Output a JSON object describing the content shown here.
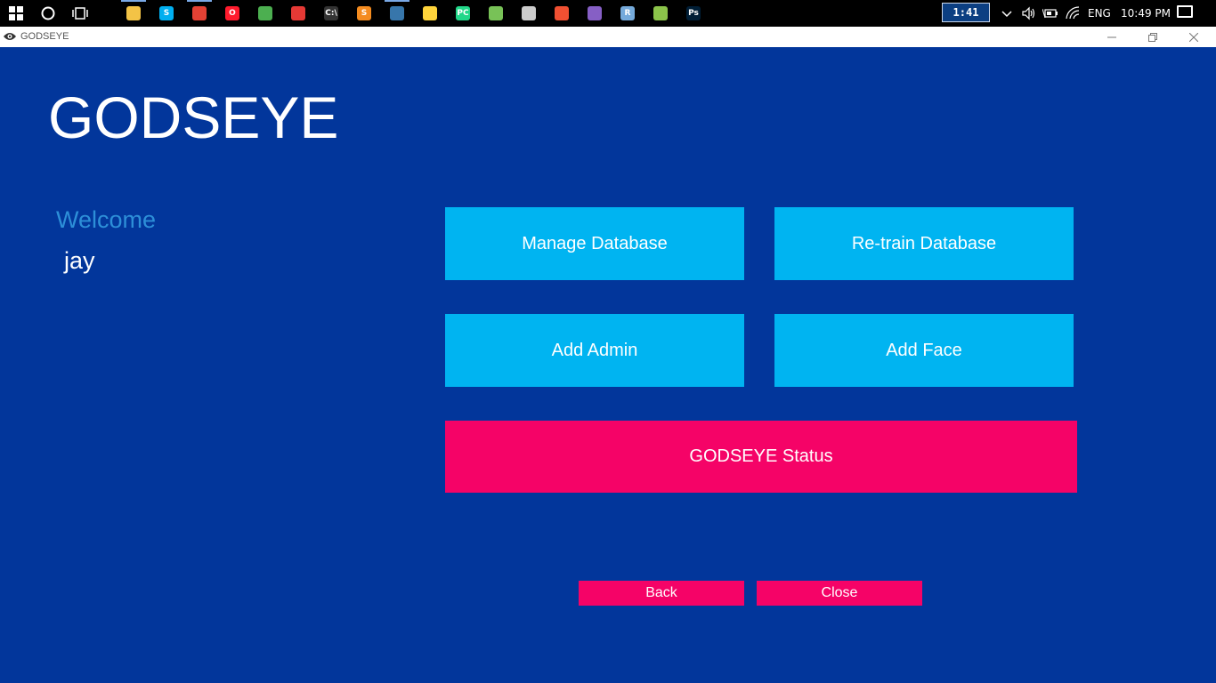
{
  "taskbar": {
    "pinned": [
      {
        "name": "file-explorer-icon",
        "color": "#f3c346",
        "glyph": "",
        "running": true
      },
      {
        "name": "skype-icon",
        "color": "#00aff0",
        "glyph": "S",
        "running": false
      },
      {
        "name": "chrome-icon",
        "color": "#e44134",
        "glyph": "",
        "running": true
      },
      {
        "name": "opera-icon",
        "color": "#ff1b2d",
        "glyph": "O",
        "running": false
      },
      {
        "name": "maps-app-icon",
        "color": "#4caf50",
        "glyph": "",
        "running": false
      },
      {
        "name": "popcorn-icon",
        "color": "#e53935",
        "glyph": "",
        "running": false
      },
      {
        "name": "command-prompt-icon",
        "color": "#333333",
        "glyph": "C:\\",
        "running": false
      },
      {
        "name": "sublime-text-icon",
        "color": "#f48b1f",
        "glyph": "S",
        "running": false
      },
      {
        "name": "python-idle-icon",
        "color": "#3776ab",
        "glyph": "",
        "running": true
      },
      {
        "name": "python-icon",
        "color": "#ffd43b",
        "glyph": "",
        "running": false
      },
      {
        "name": "pycharm-icon",
        "color": "#21d789",
        "glyph": "PC",
        "running": false
      },
      {
        "name": "android-studio-icon",
        "color": "#78c257",
        "glyph": "",
        "running": false
      },
      {
        "name": "unity-icon",
        "color": "#cccccc",
        "glyph": "",
        "running": false
      },
      {
        "name": "git-icon",
        "color": "#f05032",
        "glyph": "",
        "running": false
      },
      {
        "name": "visual-studio-icon",
        "color": "#865fc5",
        "glyph": "",
        "running": false
      },
      {
        "name": "r-studio-icon",
        "color": "#75aadb",
        "glyph": "R",
        "running": false
      },
      {
        "name": "image-viewer-icon",
        "color": "#8bc34a",
        "glyph": "",
        "running": false
      },
      {
        "name": "photoshop-icon",
        "color": "#001e36",
        "glyph": "Ps",
        "running": false
      }
    ],
    "battery_timer": "1:41",
    "language": "ENG",
    "time": "10:49 PM"
  },
  "window": {
    "title": "GODSEYE"
  },
  "main": {
    "heading": "GODSEYE",
    "welcome_label": "Welcome",
    "username": "jay",
    "buttons": {
      "manage_database": "Manage Database",
      "retrain_database": "Re-train Database",
      "add_admin": "Add Admin",
      "add_face": "Add Face",
      "status": "GODSEYE Status",
      "back": "Back",
      "close": "Close"
    }
  },
  "colors": {
    "background": "#02369b",
    "accent_cyan": "#00b4f1",
    "accent_pink": "#f50367",
    "welcome_text": "#2d8fd8"
  }
}
